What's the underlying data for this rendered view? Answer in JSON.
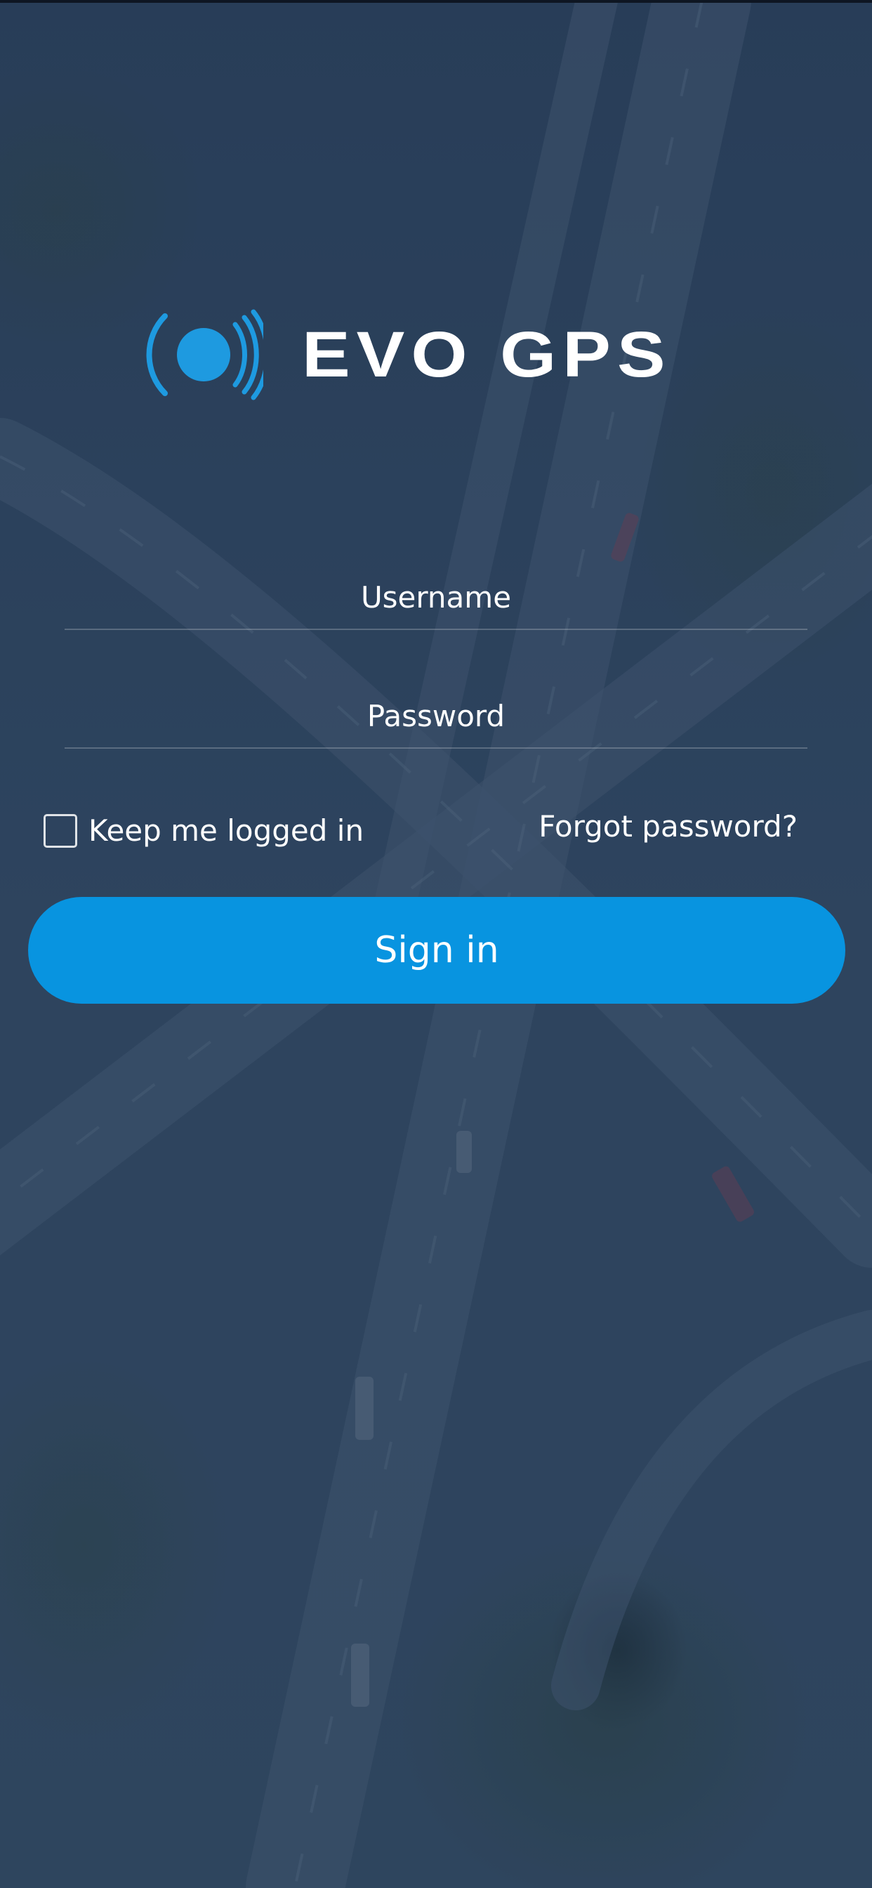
{
  "logo": {
    "text": "EVO GPS",
    "icon": "signal-broadcast-icon",
    "accent_color": "#1e9ae0"
  },
  "form": {
    "username_placeholder": "Username",
    "username_value": "",
    "password_placeholder": "Password",
    "password_value": "",
    "remember_label": "Keep me logged in",
    "remember_checked": false,
    "forgot_label": "Forgot password?",
    "submit_label": "Sign in"
  },
  "colors": {
    "button": "#0894e0",
    "text": "#ffffff"
  }
}
